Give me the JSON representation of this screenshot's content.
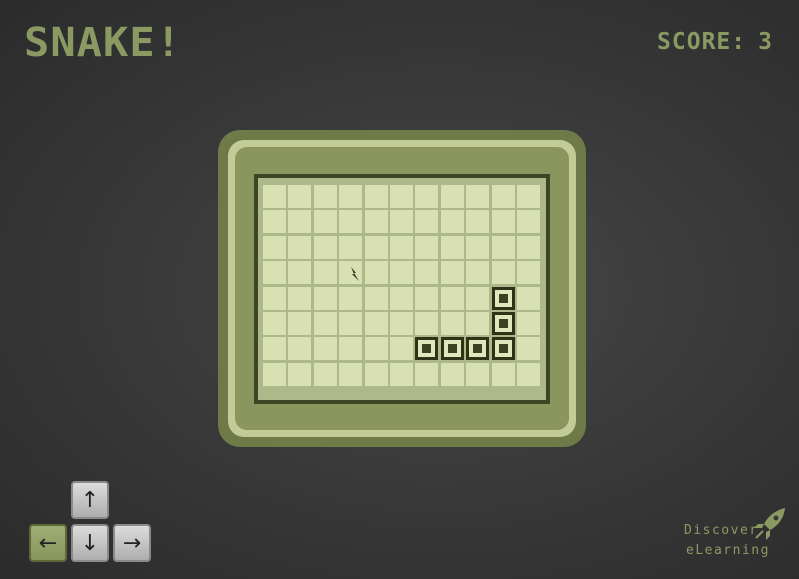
{
  "header": {
    "title": "SNAKE!",
    "score_label": "SCORE:",
    "score_value": "3"
  },
  "board": {
    "cols": 11,
    "rows": 8,
    "snake": [
      [
        9,
        4
      ],
      [
        9,
        5
      ],
      [
        9,
        6
      ],
      [
        8,
        6
      ],
      [
        7,
        6
      ],
      [
        6,
        6
      ]
    ],
    "food_icon": "lightning-icon"
  },
  "controls": {
    "up": "↑",
    "left": "←",
    "down": "↓",
    "right": "→"
  },
  "brand": {
    "line1": "Discover",
    "line2": "eLearning",
    "icon": "rocket-icon"
  },
  "colors": {
    "accent": "#8a9a62",
    "snake": "#2e3318",
    "cell": "#d8e0b4"
  }
}
